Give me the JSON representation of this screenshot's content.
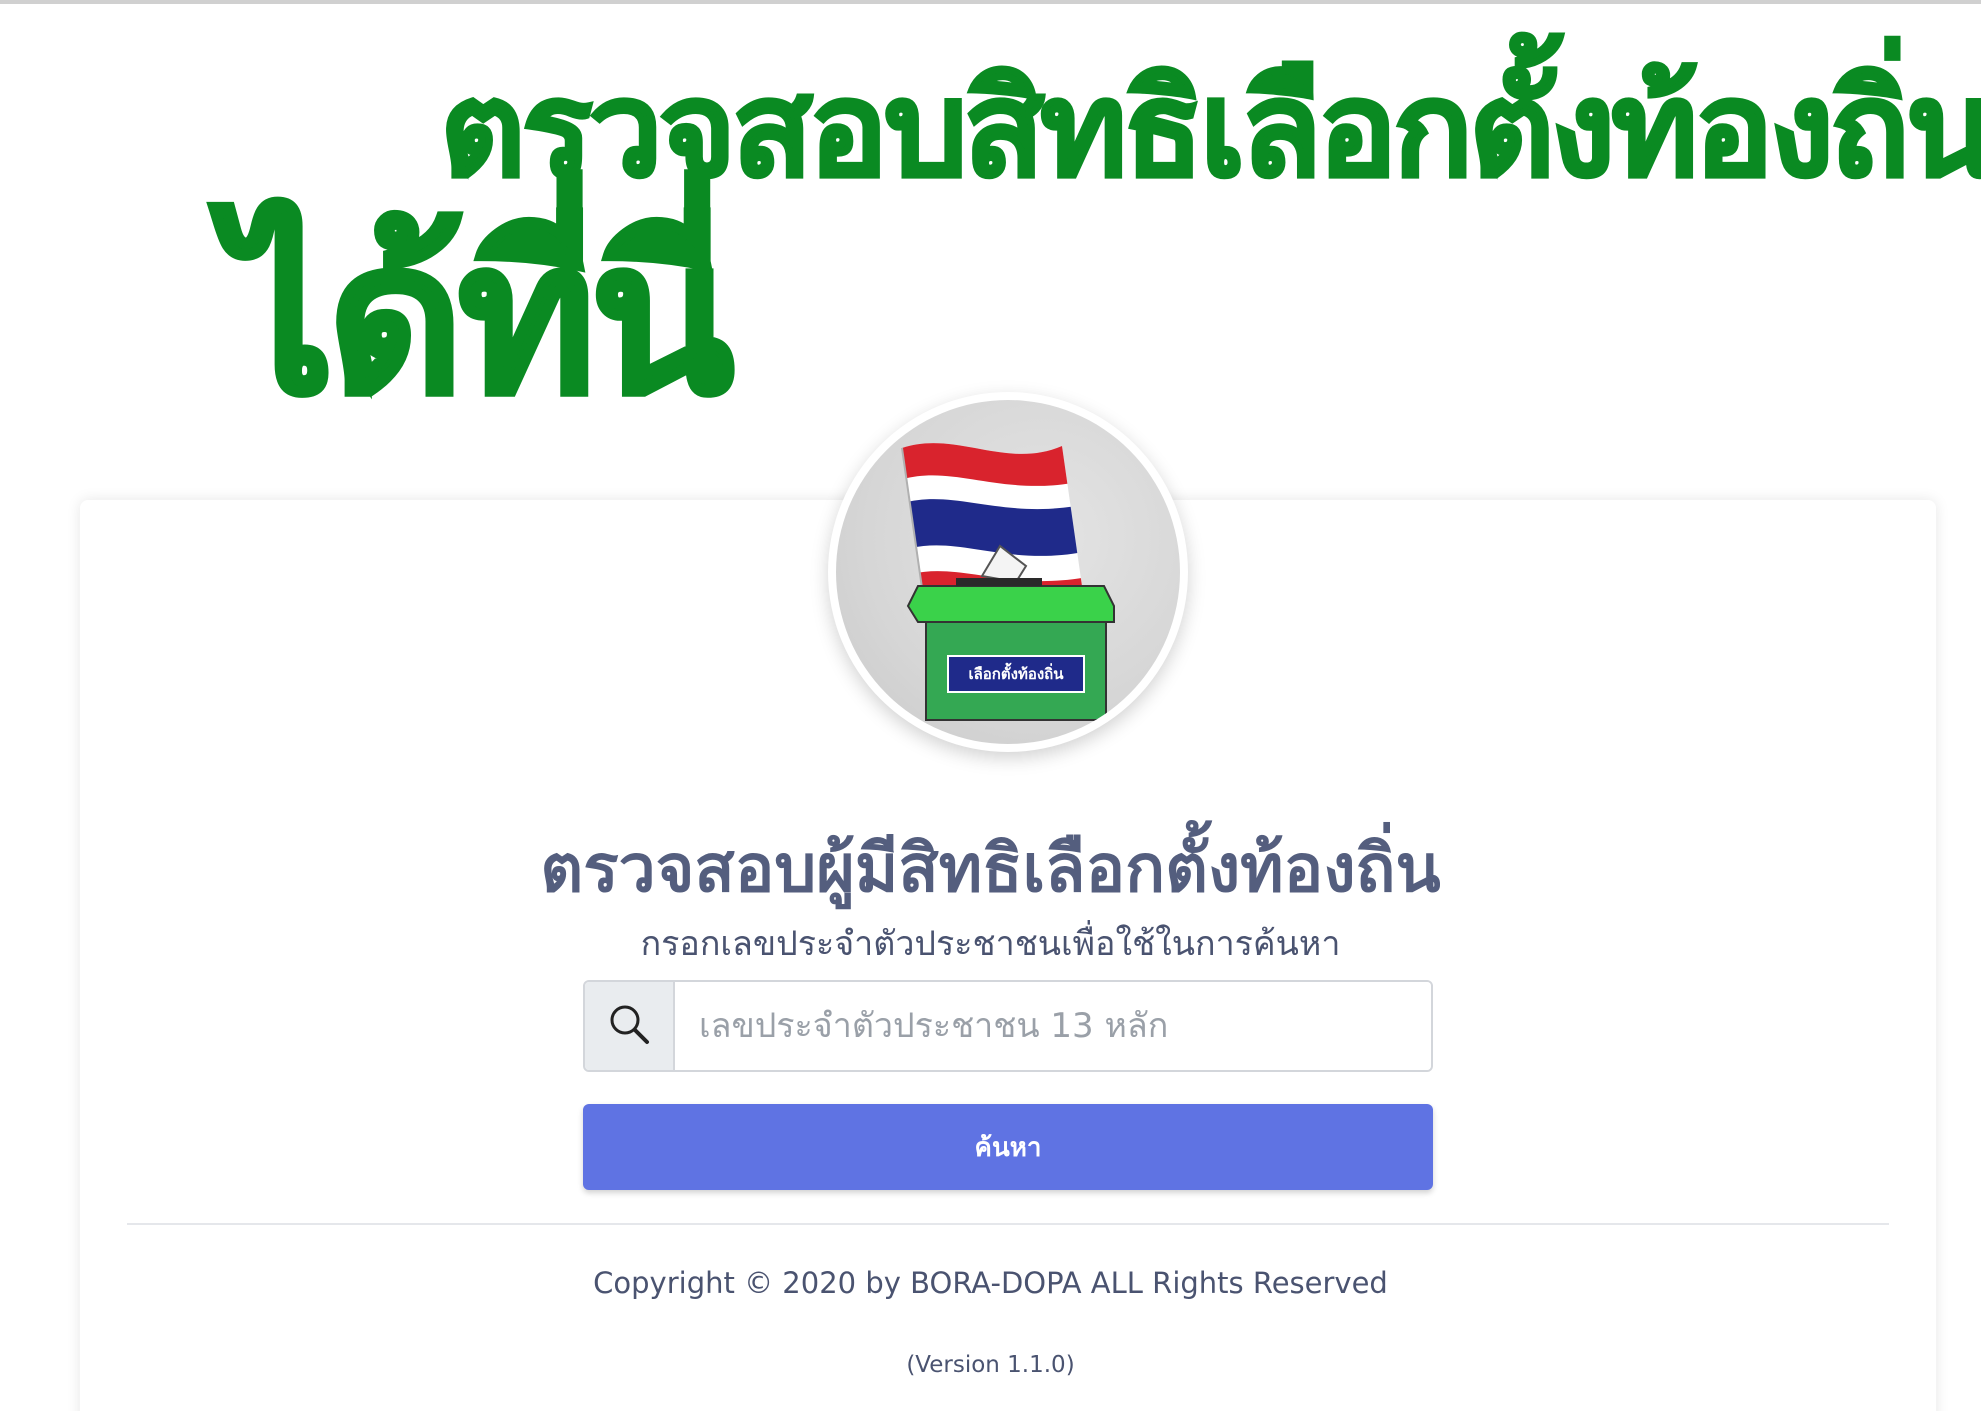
{
  "banner": {
    "line1": "ตรวจสอบสิทธิเลือกตั้งท้องถิ่น",
    "line2": "ได้ที่นี่"
  },
  "logo": {
    "box_label": "เลือกตั้งท้องถิ่น",
    "icon": "ballot-box-thai-flag-icon"
  },
  "main": {
    "title": "ตรวจสอบผู้มีสิทธิเลือกตั้งท้องถิ่น",
    "subtitle": "กรอกเลขประจำตัวประชาชนเพื่อใช้ในการค้นหา",
    "search_placeholder": "เลขประจำตัวประชาชน 13 หลัก",
    "search_value": "",
    "search_icon": "search-icon",
    "search_button_label": "ค้นหา"
  },
  "footer": {
    "copyright": "Copyright © 2020 by BORA-DOPA ALL Rights Reserved",
    "version": "(Version 1.1.0)"
  },
  "colors": {
    "banner_green": "#0a8a22",
    "title_text": "#545e7e",
    "button_bg": "#5f73e3",
    "box_green": "#34a853",
    "box_lid": "#3ad24a",
    "label_blue": "#1f2a8a"
  }
}
